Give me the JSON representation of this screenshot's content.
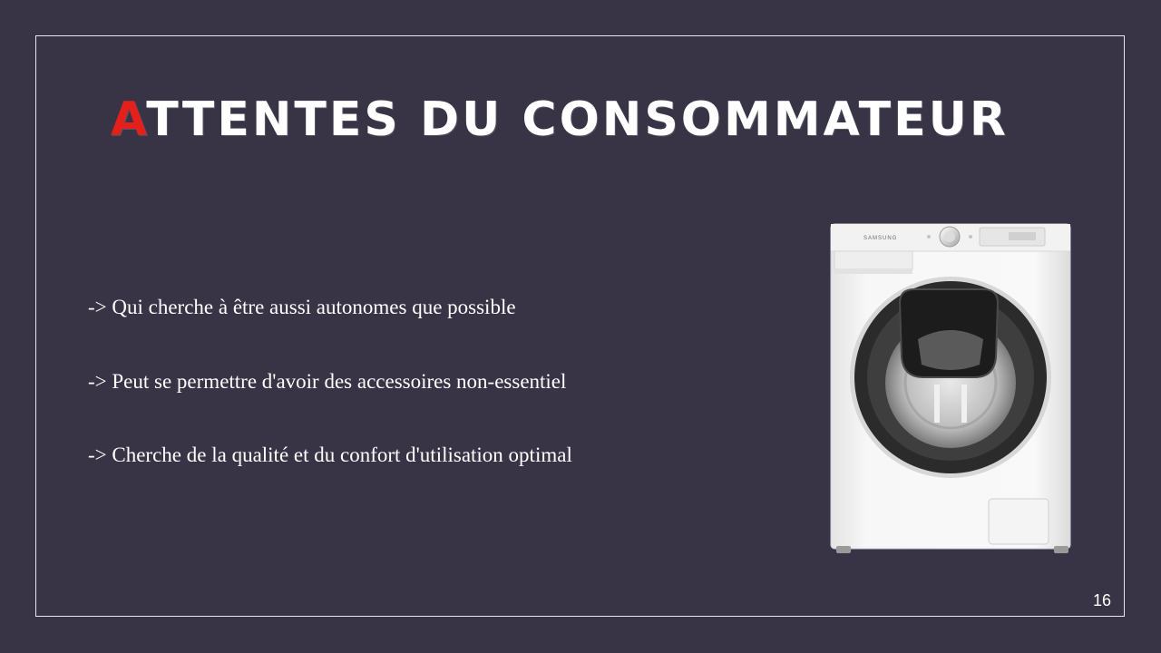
{
  "slide": {
    "title_first_letter": "A",
    "title_rest": "TTENTES DU CONSOMMATEUR",
    "bullets": [
      "-> Qui cherche à être aussi autonomes que possible",
      "-> Peut se permettre d'avoir des accessoires non-essentiel",
      "-> Cherche de la qualité et du confort d'utilisation optimal"
    ],
    "page_number": "16",
    "image": {
      "subject": "washing-machine",
      "brand_text": "SAMSUNG"
    }
  },
  "colors": {
    "background": "#383446",
    "accent": "#e3201b",
    "text": "#ffffff"
  }
}
